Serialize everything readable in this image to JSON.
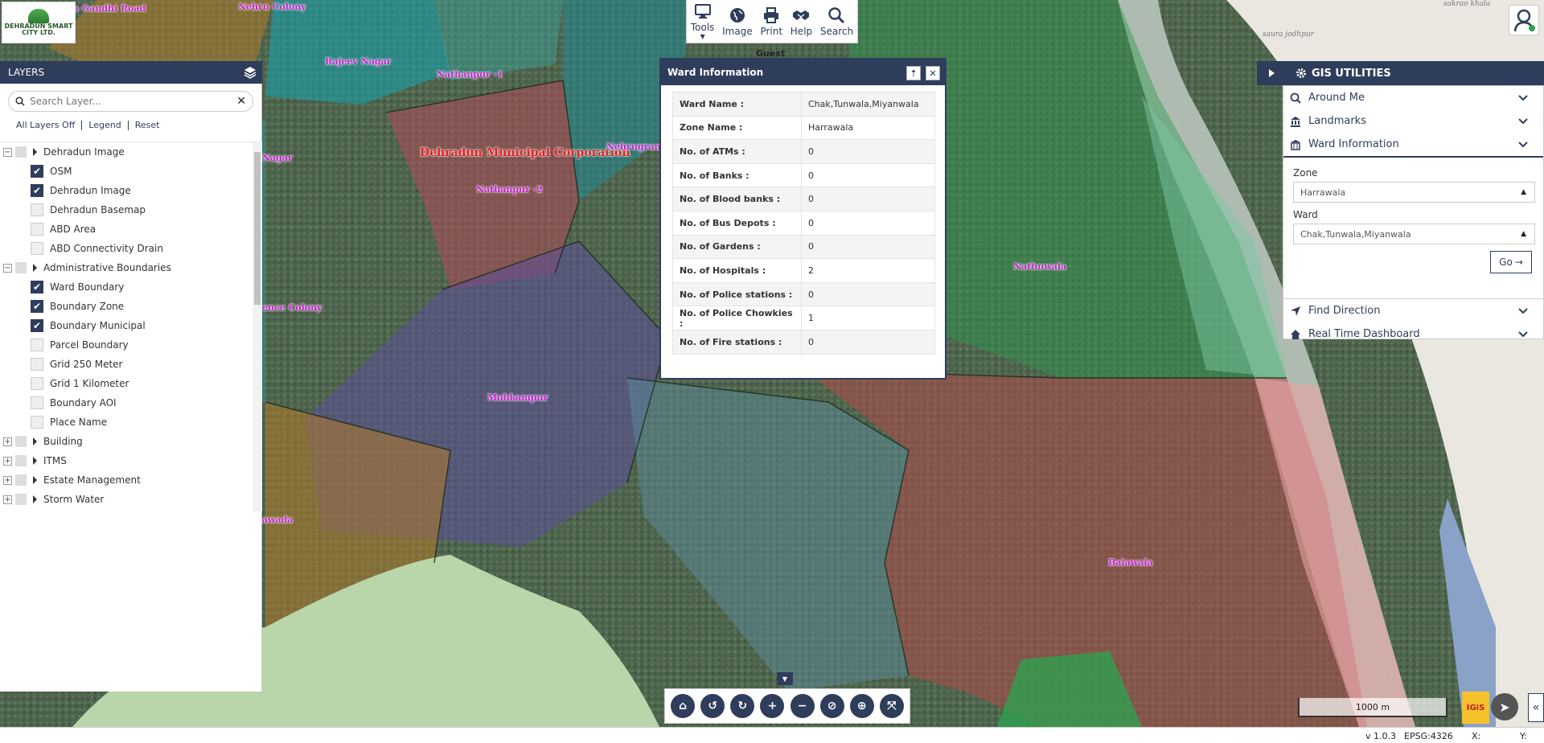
{
  "logo": {
    "text": "DEHRADUN SMART CITY LTD."
  },
  "map": {
    "places": [
      "Nehru Colony",
      "Rajeev Nagar",
      "Nathanpur -1",
      "Dehradun Municipal Corporation",
      "Nehrugram",
      "Nathanpur -2",
      "Mohkampur",
      "Nathuwala",
      "Balawala",
      "ence Colony",
      "Nagar",
      "awada",
      "Indira Gandhi Road"
    ],
    "osm_labels": [
      "saura jodhpur",
      "sakrao khala"
    ]
  },
  "layers": {
    "title": "LAYERS",
    "search_placeholder": "Search Layer...",
    "links": {
      "all_off": "All Layers Off",
      "legend": "Legend",
      "reset": "Reset"
    },
    "tree": [
      {
        "type": "group",
        "label": "Dehradun Image",
        "expanded": true
      },
      {
        "type": "layer",
        "label": "OSM",
        "checked": true
      },
      {
        "type": "layer",
        "label": "Dehradun Image",
        "checked": true
      },
      {
        "type": "layer",
        "label": "Dehradun Basemap",
        "checked": false
      },
      {
        "type": "layer",
        "label": "ABD Area",
        "checked": false
      },
      {
        "type": "layer",
        "label": "ABD Connectivity Drain",
        "checked": false
      },
      {
        "type": "group",
        "label": "Administrative Boundaries",
        "expanded": true
      },
      {
        "type": "layer",
        "label": "Ward Boundary",
        "checked": true
      },
      {
        "type": "layer",
        "label": "Boundary Zone",
        "checked": true
      },
      {
        "type": "layer",
        "label": "Boundary Municipal",
        "checked": true
      },
      {
        "type": "layer",
        "label": "Parcel Boundary",
        "checked": false
      },
      {
        "type": "layer",
        "label": "Grid 250 Meter",
        "checked": false
      },
      {
        "type": "layer",
        "label": "Grid 1 Kilometer",
        "checked": false
      },
      {
        "type": "layer",
        "label": "Boundary AOI",
        "checked": false
      },
      {
        "type": "layer",
        "label": "Place Name",
        "checked": false
      },
      {
        "type": "group",
        "label": "Building",
        "expanded": false
      },
      {
        "type": "group",
        "label": "ITMS",
        "expanded": false
      },
      {
        "type": "group",
        "label": "Estate Management",
        "expanded": false
      },
      {
        "type": "group",
        "label": "Storm Water",
        "expanded": false
      }
    ]
  },
  "toolbar": {
    "tools": [
      {
        "label": "Tools",
        "icon": "monitor-icon",
        "dropdown": true
      },
      {
        "label": "Image",
        "icon": "globe-icon"
      },
      {
        "label": "Print",
        "icon": "printer-icon"
      },
      {
        "label": "Help",
        "icon": "handshake-icon"
      },
      {
        "label": "Search",
        "icon": "search-icon"
      }
    ],
    "user": "Guest"
  },
  "ward_dialog": {
    "title": "Ward Information",
    "rows": [
      {
        "key": "Ward Name :",
        "value": "Chak,Tunwala,Miyanwala"
      },
      {
        "key": "Zone Name :",
        "value": "Harrawala"
      },
      {
        "key": "No. of ATMs :",
        "value": "0"
      },
      {
        "key": "No. of Banks :",
        "value": "0"
      },
      {
        "key": "No. of Blood banks :",
        "value": "0"
      },
      {
        "key": "No. of Bus Depots :",
        "value": "0"
      },
      {
        "key": "No. of Gardens :",
        "value": "0"
      },
      {
        "key": "No. of Hospitals :",
        "value": "2"
      },
      {
        "key": "No. of Police stations :",
        "value": "0"
      },
      {
        "key": "No. of Police Chowkies :",
        "value": "1"
      },
      {
        "key": "No. of Fire stations :",
        "value": "0"
      }
    ]
  },
  "gis": {
    "title": "GIS UTILITIES",
    "items": {
      "around_me": "Around Me",
      "landmarks": "Landmarks",
      "ward_info": "Ward Information",
      "find_direction": "Find Direction",
      "dashboard": "Real Time Dashboard"
    },
    "form": {
      "zone_label": "Zone",
      "zone_value": "Harrawala",
      "ward_label": "Ward",
      "ward_value": "Chak,Tunwala,Miyanwala",
      "go": "Go"
    }
  },
  "scale": "1000 m",
  "igis": "IGiS",
  "status": {
    "version": "v 1.0.3",
    "epsg": "EPSG:4326",
    "x": "X:",
    "y": "Y:"
  },
  "colors": {
    "accent": "#2f3d5c",
    "place_label": "#c61fd0",
    "corp_label": "#e01f1f"
  }
}
